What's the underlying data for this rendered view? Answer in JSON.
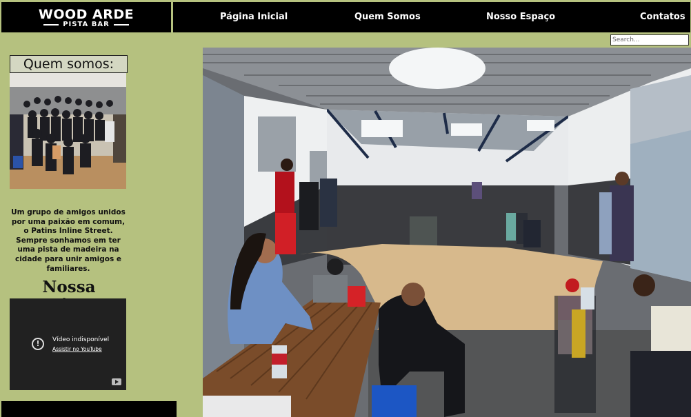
{
  "logo": {
    "title": "WOOD ARDE",
    "subtitle": "PISTA BAR"
  },
  "nav": {
    "items": [
      {
        "label": "Página Inicial"
      },
      {
        "label": "Quem Somos"
      },
      {
        "label": "Nosso Espaço"
      },
      {
        "label": "Contatos"
      }
    ]
  },
  "search": {
    "placeholder": "Search..."
  },
  "sidebar": {
    "title": "Quem somos:",
    "description": "Um grupo de amigos unidos por uma paixão em comum, o Patins Inline Street. Sempre sonhamos em ter uma pista de madeira na cidade para unir amigos e familiares.",
    "essence_title": "Nossa essência"
  },
  "video": {
    "status": "Vídeo indisponível",
    "link": "Assistir no YouTube"
  },
  "colors": {
    "background": "#b5c17f",
    "bars": "#000000"
  }
}
